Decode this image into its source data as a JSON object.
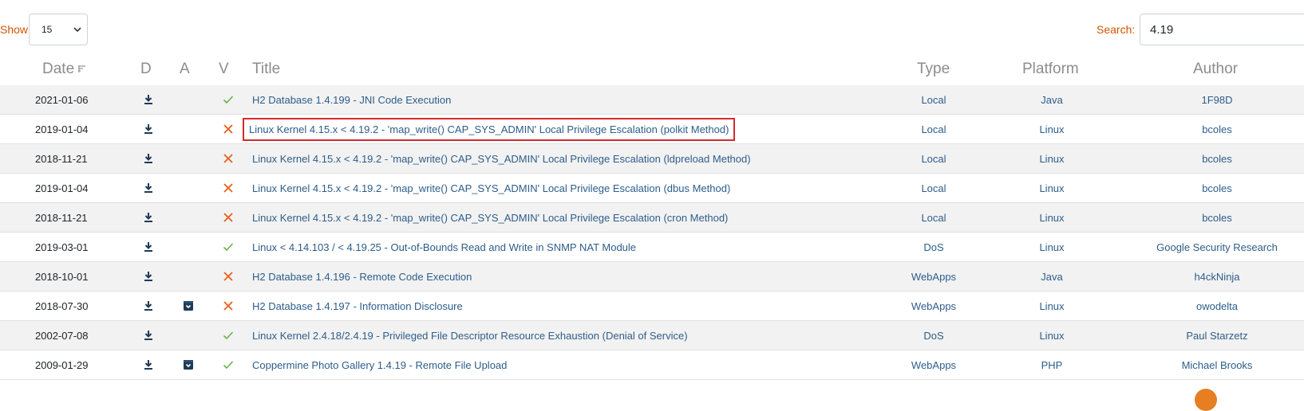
{
  "controls": {
    "show_label": "Show",
    "entries_value": "15",
    "search_label": "Search:",
    "search_value": "4.19"
  },
  "columns": {
    "date": "Date",
    "download": "D",
    "application": "A",
    "verified": "V",
    "title": "Title",
    "type": "Type",
    "platform": "Platform",
    "author": "Author"
  },
  "colors": {
    "accent_orange": "#d35400",
    "link_blue": "#2d5d8a",
    "verified_green": "#6ab04c",
    "unverified_orange": "#e8601c",
    "highlight_box": "#d62828"
  },
  "icons": {
    "download": "download-icon",
    "application": "archive-icon",
    "verified": "check-icon",
    "unverified": "x-icon",
    "sort": "sort-icon",
    "select": "chevron-down-icon"
  },
  "rows": [
    {
      "date": "2021-01-06",
      "app": false,
      "verified": true,
      "title": "H2 Database 1.4.199 - JNI Code Execution",
      "type": "Local",
      "platform": "Java",
      "author": "1F98D",
      "highlighted": false
    },
    {
      "date": "2019-01-04",
      "app": false,
      "verified": false,
      "title": "Linux Kernel 4.15.x < 4.19.2 - 'map_write() CAP_SYS_ADMIN' Local Privilege Escalation (polkit Method)",
      "type": "Local",
      "platform": "Linux",
      "author": "bcoles",
      "highlighted": true
    },
    {
      "date": "2018-11-21",
      "app": false,
      "verified": false,
      "title": "Linux Kernel 4.15.x < 4.19.2 - 'map_write() CAP_SYS_ADMIN' Local Privilege Escalation (ldpreload Method)",
      "type": "Local",
      "platform": "Linux",
      "author": "bcoles",
      "highlighted": false
    },
    {
      "date": "2019-01-04",
      "app": false,
      "verified": false,
      "title": "Linux Kernel 4.15.x < 4.19.2 - 'map_write() CAP_SYS_ADMIN' Local Privilege Escalation (dbus Method)",
      "type": "Local",
      "platform": "Linux",
      "author": "bcoles",
      "highlighted": false
    },
    {
      "date": "2018-11-21",
      "app": false,
      "verified": false,
      "title": "Linux Kernel 4.15.x < 4.19.2 - 'map_write() CAP_SYS_ADMIN' Local Privilege Escalation (cron Method)",
      "type": "Local",
      "platform": "Linux",
      "author": "bcoles",
      "highlighted": false
    },
    {
      "date": "2019-03-01",
      "app": false,
      "verified": true,
      "title": "Linux < 4.14.103 / < 4.19.25 - Out-of-Bounds Read and Write in SNMP NAT Module",
      "type": "DoS",
      "platform": "Linux",
      "author": "Google Security Research",
      "highlighted": false
    },
    {
      "date": "2018-10-01",
      "app": false,
      "verified": false,
      "title": "H2 Database 1.4.196 - Remote Code Execution",
      "type": "WebApps",
      "platform": "Java",
      "author": "h4ckNinja",
      "highlighted": false
    },
    {
      "date": "2018-07-30",
      "app": true,
      "verified": false,
      "title": "H2 Database 1.4.197 - Information Disclosure",
      "type": "WebApps",
      "platform": "Linux",
      "author": "owodelta",
      "highlighted": false
    },
    {
      "date": "2002-07-08",
      "app": false,
      "verified": true,
      "title": "Linux Kernel 2.4.18/2.4.19 - Privileged File Descriptor Resource Exhaustion (Denial of Service)",
      "type": "DoS",
      "platform": "Linux",
      "author": "Paul Starzetz",
      "highlighted": false
    },
    {
      "date": "2009-01-29",
      "app": true,
      "verified": true,
      "title": "Coppermine Photo Gallery 1.4.19 - Remote File Upload",
      "type": "WebApps",
      "platform": "PHP",
      "author": "Michael Brooks",
      "highlighted": false
    }
  ]
}
